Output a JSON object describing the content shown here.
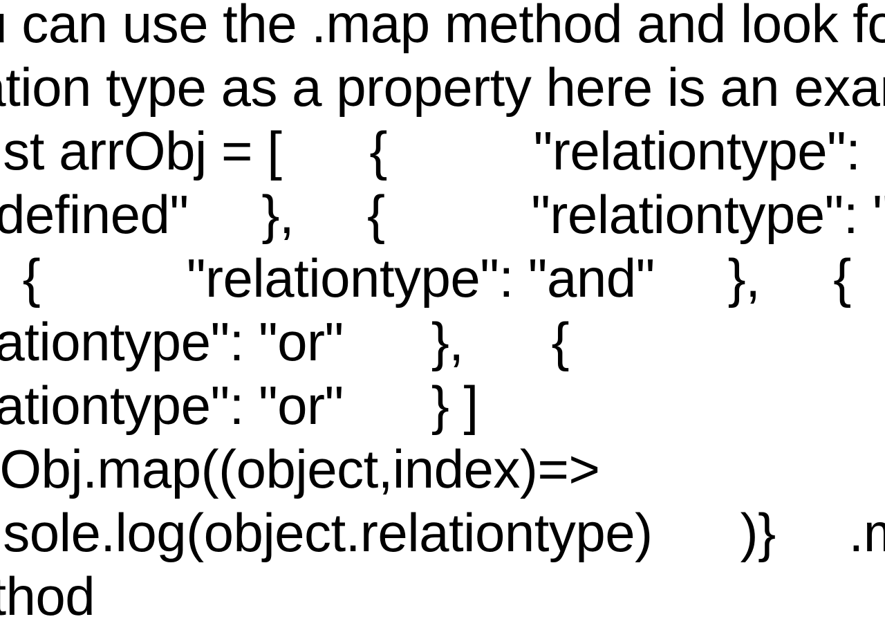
{
  "answer_text": "You can use the .map method and look for the relation type as a property here is an example   const arrObj = [      {          \"relationtype\": \"undefined\"     },     {          \"relationtype\": \"or\"     },     {          \"relationtype\": \"and\"     },     {          \"relationtype\": \"or\"      },      {           \"relationtype\": \"or\"      } ]   {arrObj.map((object,index)=> console.log(object.relationtype)      )}     .map() Method"
}
